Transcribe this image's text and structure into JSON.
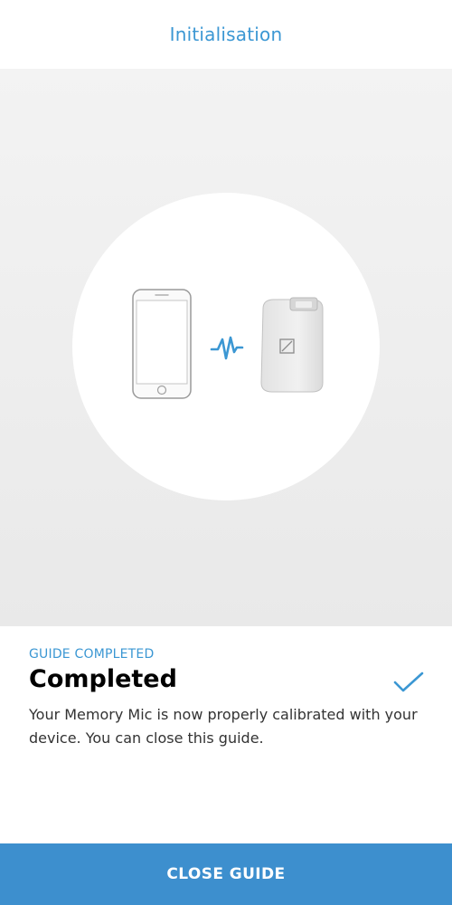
{
  "header": {
    "title": "Initialisation"
  },
  "hero": {
    "phone_icon": "smartphone-icon",
    "connection_icon": "connection-zigzag-icon",
    "device_icon": "memory-mic-device-icon",
    "logo_icon": "sennheiser-logo-icon"
  },
  "status": {
    "kicker": "GUIDE COMPLETED",
    "title": "Completed",
    "description": "Your Memory Mic is now properly calibrated with your device. You can close this guide.",
    "status_icon": "checkmark-icon"
  },
  "footer": {
    "close_label": "CLOSE GUIDE"
  },
  "colors": {
    "accent": "#3b97d3",
    "button": "#3d8fce",
    "hero_background": "#eeeeee"
  }
}
